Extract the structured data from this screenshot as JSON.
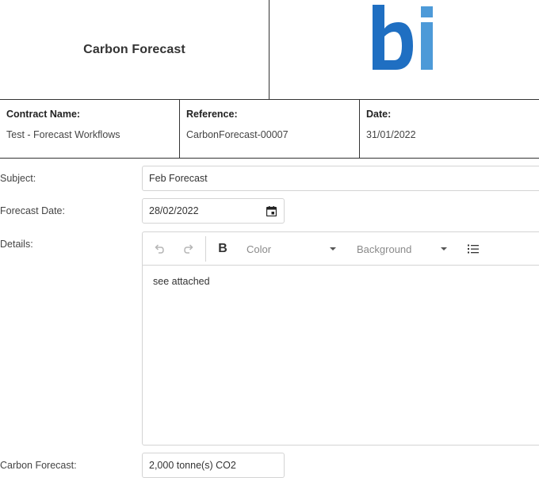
{
  "header": {
    "title": "Carbon Forecast",
    "logo_text": "bi",
    "logo_colors": {
      "b": "#1f6fc2",
      "i": "#4d9ad8"
    }
  },
  "info": {
    "contract_label": "Contract Name:",
    "contract_value": "Test - Forecast Workflows",
    "reference_label": "Reference:",
    "reference_value": "CarbonForecast-00007",
    "date_label": "Date:",
    "date_value": "31/01/2022"
  },
  "form": {
    "subject_label": "Subject:",
    "subject_value": "Feb Forecast",
    "forecast_date_label": "Forecast Date:",
    "forecast_date_value": "28/02/2022",
    "details_label": "Details:",
    "carbon_forecast_label": "Carbon Forecast:",
    "carbon_forecast_value": "2,000 tonne(s) CO2"
  },
  "editor": {
    "toolbar": {
      "undo_icon": "undo-icon",
      "redo_icon": "redo-icon",
      "bold_label": "B",
      "color_label": "Color",
      "background_label": "Background",
      "list_icon": "bulleted-list-icon"
    },
    "content": "see attached"
  }
}
